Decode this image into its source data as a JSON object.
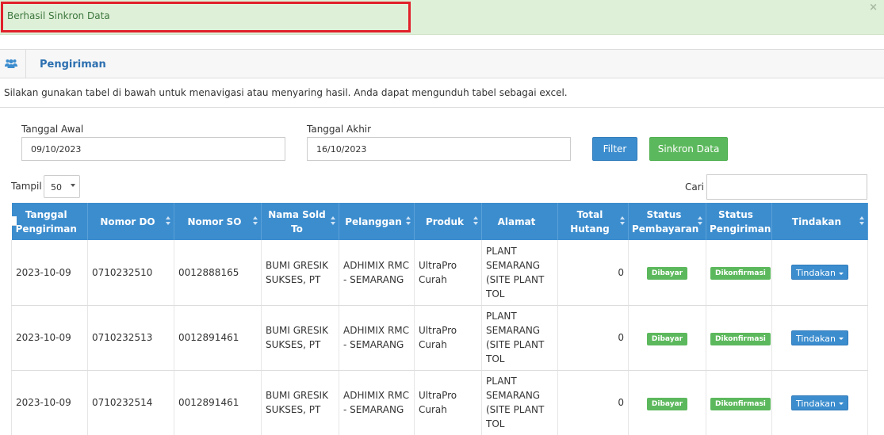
{
  "alert": {
    "message": "Berhasil Sinkron Data",
    "close": "×"
  },
  "panel": {
    "title": "Pengiriman",
    "icon": "users-icon"
  },
  "description": "Silakan gunakan tabel di bawah untuk menavigasi atau menyaring hasil. Anda dapat mengunduh tabel sebagai excel.",
  "filters": {
    "start_label": "Tanggal Awal",
    "start_value": "09/10/2023",
    "end_label": "Tanggal Akhir",
    "end_value": "16/10/2023",
    "filter_button": "Filter",
    "sync_button": "Sinkron Data"
  },
  "table_controls": {
    "show_label": "Tampil",
    "show_value": "50",
    "search_label": "Cari",
    "search_value": ""
  },
  "table": {
    "headers": [
      "Tanggal Pengiriman",
      "Nomor DO",
      "Nomor SO",
      "Nama Sold To",
      "Pelanggan",
      "Produk",
      "Alamat",
      "Total Hutang",
      "Status Pembayaran",
      "Status Pengiriman",
      "Tindakan"
    ],
    "rows": [
      {
        "tanggal": "2023-10-09",
        "do": "0710232510",
        "so": "0012888165",
        "sold_to": "BUMI GRESIK SUKSES, PT",
        "pelanggan": "ADHIMIX RMC - SEMARANG",
        "produk": "UltraPro Curah",
        "alamat": "PLANT SEMARANG (SITE PLANT TOL",
        "hutang": "0",
        "pembayaran": "Dibayar",
        "pengiriman": "Dikonfirmasi",
        "aksi": "Tindakan"
      },
      {
        "tanggal": "2023-10-09",
        "do": "0710232513",
        "so": "0012891461",
        "sold_to": "BUMI GRESIK SUKSES, PT",
        "pelanggan": "ADHIMIX RMC - SEMARANG",
        "produk": "UltraPro Curah",
        "alamat": "PLANT SEMARANG (SITE PLANT TOL",
        "hutang": "0",
        "pembayaran": "Dibayar",
        "pengiriman": "Dikonfirmasi",
        "aksi": "Tindakan"
      },
      {
        "tanggal": "2023-10-09",
        "do": "0710232514",
        "so": "0012891461",
        "sold_to": "BUMI GRESIK SUKSES, PT",
        "pelanggan": "ADHIMIX RMC - SEMARANG",
        "produk": "UltraPro Curah",
        "alamat": "PLANT SEMARANG (SITE PLANT TOL",
        "hutang": "0",
        "pembayaran": "Dibayar",
        "pengiriman": "Dikonfirmasi",
        "aksi": "Tindakan"
      }
    ]
  },
  "colors": {
    "primary": "#3c8dce",
    "success": "#5cb85c",
    "alert_bg": "#dff0d8",
    "highlight": "#e1202a"
  }
}
